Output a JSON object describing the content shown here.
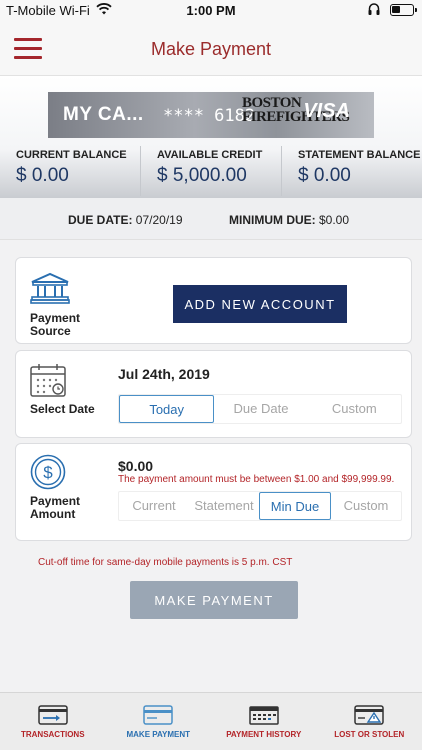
{
  "status_bar": {
    "carrier": "T-Mobile Wi-Fi",
    "time": "1:00 PM"
  },
  "header": {
    "title": "Make Payment"
  },
  "card": {
    "name": "MY CA...",
    "digits": "**** 6182",
    "issuer_line1": "BOSTON",
    "issuer_line2": "FIREFIGHTERS",
    "brand": "VISA"
  },
  "balances": [
    {
      "label": "CURRENT BALANCE",
      "value": "$ 0.00"
    },
    {
      "label": "AVAILABLE CREDIT",
      "value": "$ 5,000.00"
    },
    {
      "label": "STATEMENT BALANCE",
      "value": "$ 0.00"
    }
  ],
  "due": {
    "due_label": "DUE DATE:",
    "due_value": "07/20/19",
    "min_label": "MINIMUM DUE:",
    "min_value": "$0.00"
  },
  "payment_source": {
    "label_line1": "Payment",
    "label_line2": "Source",
    "button": "ADD NEW ACCOUNT"
  },
  "select_date": {
    "label": "Select Date",
    "value": "Jul 24th, 2019",
    "options": [
      "Today",
      "Due Date",
      "Custom"
    ],
    "selected": "Today"
  },
  "payment_amount": {
    "label_line1": "Payment",
    "label_line2": "Amount",
    "value": "$0.00",
    "note": "The payment amount must be between $1.00 and $99,999.99.",
    "options": [
      "Current",
      "Statement",
      "Min Due",
      "Custom"
    ],
    "selected": "Min Due"
  },
  "cutoff_note": "Cut-off time for same-day mobile payments is 5 p.m. CST",
  "make_payment_button": "MAKE PAYMENT",
  "tabs": [
    {
      "label": "TRANSACTIONS",
      "icon": "card-arrow-icon"
    },
    {
      "label": "MAKE PAYMENT",
      "icon": "card-icon",
      "active": true
    },
    {
      "label": "PAYMENT HISTORY",
      "icon": "calendar-history-icon"
    },
    {
      "label": "LOST OR STOLEN",
      "icon": "card-warning-icon"
    }
  ],
  "colors": {
    "brand_red": "#9b2c2c",
    "navy": "#1b2f63",
    "accent_blue": "#2a6fb0",
    "disabled_button": "#9aa6b4",
    "error_red": "#b32428"
  }
}
